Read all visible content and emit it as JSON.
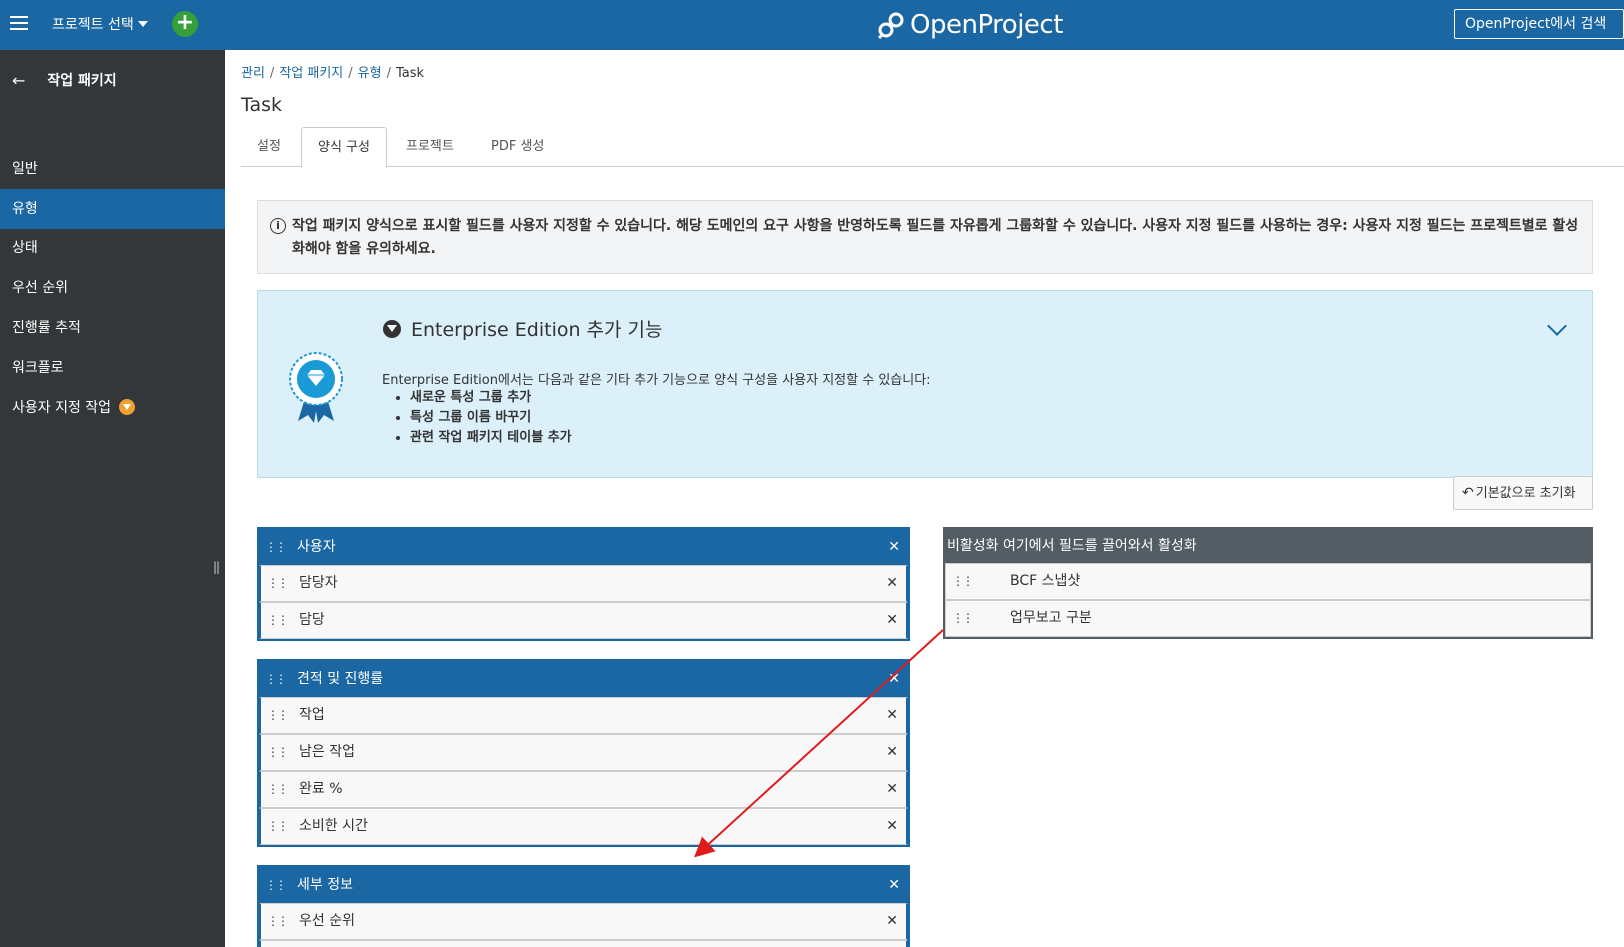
{
  "header": {
    "project_select": "프로젝트 선택",
    "logo_text": "OpenProject",
    "search_label": "OpenProject에서 검색"
  },
  "sidebar": {
    "back_title": "작업 패키지",
    "items": [
      {
        "label": "일반"
      },
      {
        "label": "유형"
      },
      {
        "label": "상태"
      },
      {
        "label": "우선 순위"
      },
      {
        "label": "진행률 추적"
      },
      {
        "label": "워크플로"
      },
      {
        "label": "사용자 지정 작업"
      }
    ],
    "active_item": "유형"
  },
  "breadcrumb": {
    "items": [
      "관리",
      "작업 패키지",
      "유형"
    ],
    "current": "Task"
  },
  "page_title": "Task",
  "tabs": {
    "items": [
      "설정",
      "양식 구성",
      "프로젝트",
      "PDF 생성"
    ],
    "active": "양식 구성"
  },
  "info_text": "작업 패키지 양식으로 표시할 필드를 사용자 지정할 수 있습니다. 해당 도메인의 요구 사항을 반영하도록 필드를 자유롭게 그룹화할 수 있습니다. 사용자 지정 필드를 사용하는 경우: 사용자 지정 필드는 프로젝트별로 활성화해야 함을 유의하세요.",
  "enterprise": {
    "title": "Enterprise Edition 추가 기능",
    "description": "Enterprise Edition에서는 다음과 같은 기타 추가 기능으로 양식 구성을 사용자 지정할 수 있습니다:",
    "features": [
      "새로운 특성 그룹 추가",
      "특성 그룹 이름 바꾸기",
      "관련 작업 패키지 테이블 추가"
    ]
  },
  "reset_button": "기본값으로 초기화",
  "groups": [
    {
      "title": "사용자",
      "fields": [
        "담당자",
        "담당"
      ]
    },
    {
      "title": "견적 및 진행률",
      "fields": [
        "작업",
        "남은 작업",
        "완료 %",
        "소비한 시간"
      ]
    },
    {
      "title": "세부 정보",
      "fields": [
        "우선 순위"
      ]
    }
  ],
  "inactive": {
    "title": "비활성화 여기에서 필드를 끌어와서 활성화",
    "fields": [
      "BCF 스냅샷",
      "업무보고 구분"
    ]
  },
  "colors": {
    "brand_blue": "#1a67a3",
    "sidebar_bg": "#333739",
    "annotation_arrow": "#e01b1b"
  }
}
